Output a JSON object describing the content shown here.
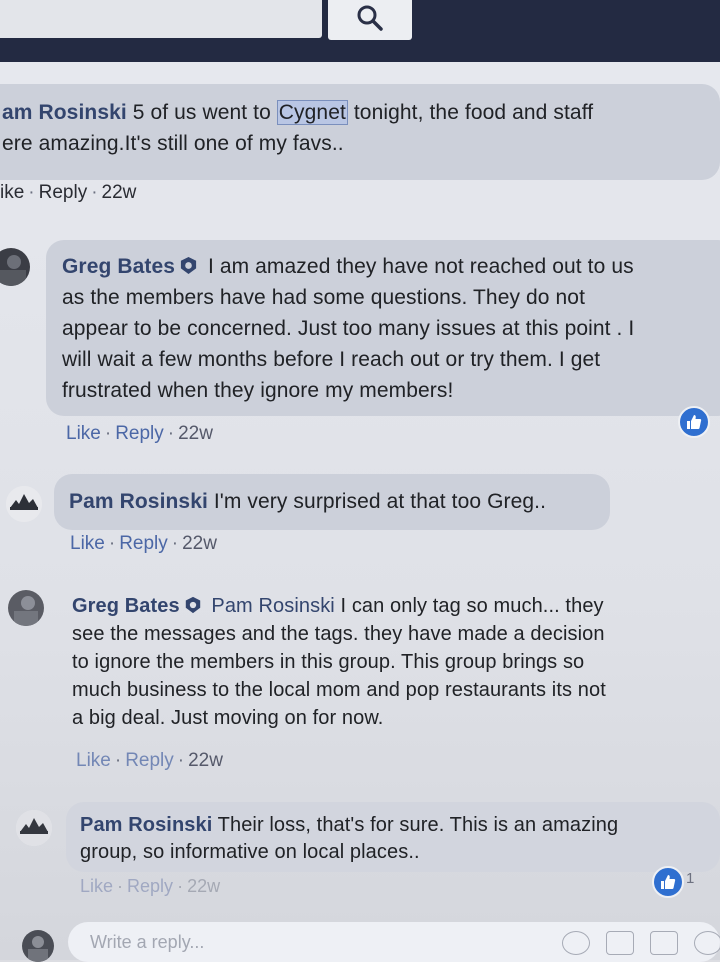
{
  "search": {
    "icon": "search-icon"
  },
  "comments": [
    {
      "author": "am Rosinski",
      "text_line1": " 5 of us went to ",
      "highlight": "Cygnet",
      "text_line1_end": " tonight, the food and staff",
      "text_line2": "ere amazing.It's still one of my favs..",
      "actions": {
        "like": "ike",
        "reply": "Reply",
        "time": "22w"
      }
    },
    {
      "author": "Greg Bates",
      "lines": [
        " I am amazed they have not reached out to us",
        "as the members have had some questions. They do not",
        "appear to be concerned. Just too many issues at this point . I",
        "will wait a few months before I reach out or try them. I get",
        "frustrated when they ignore my members!"
      ],
      "actions": {
        "like": "Like",
        "reply": "Reply",
        "time": "22w"
      },
      "reaction_icon": "like-icon"
    },
    {
      "author": "Pam Rosinski",
      "text": " I'm very surprised at that too Greg..",
      "actions": {
        "like": "Like",
        "reply": "Reply",
        "time": "22w"
      }
    },
    {
      "author": "Greg Bates",
      "tag": " Pam Rosinski",
      "lines": [
        " I can only tag so much... they",
        "see the messages and the tags. they have made a decision",
        "to ignore the members in this group. This group brings so",
        "much business to the local mom and pop restaurants its not",
        "a big deal. Just moving on for now."
      ],
      "actions": {
        "like": "Like",
        "reply": "Reply",
        "time": "22w"
      }
    },
    {
      "author": "Pam Rosinski",
      "lines": [
        " Their loss, that's for sure. This is an amazing",
        "group, so informative on local places.."
      ],
      "actions": {
        "like": "Like",
        "reply": "Reply",
        "time": "22w"
      },
      "reaction_icon": "like-icon",
      "reaction_count": "1"
    }
  ],
  "composer": {
    "placeholder": "Write a reply...",
    "icons": [
      "emoji-icon",
      "camera-icon",
      "gif-icon",
      "sticker-icon"
    ]
  },
  "colors": {
    "topbar": "#232a42",
    "link": "#4b67a6",
    "name": "#33456e",
    "bubble": "#ccd0da",
    "like": "#2f6fd0"
  }
}
